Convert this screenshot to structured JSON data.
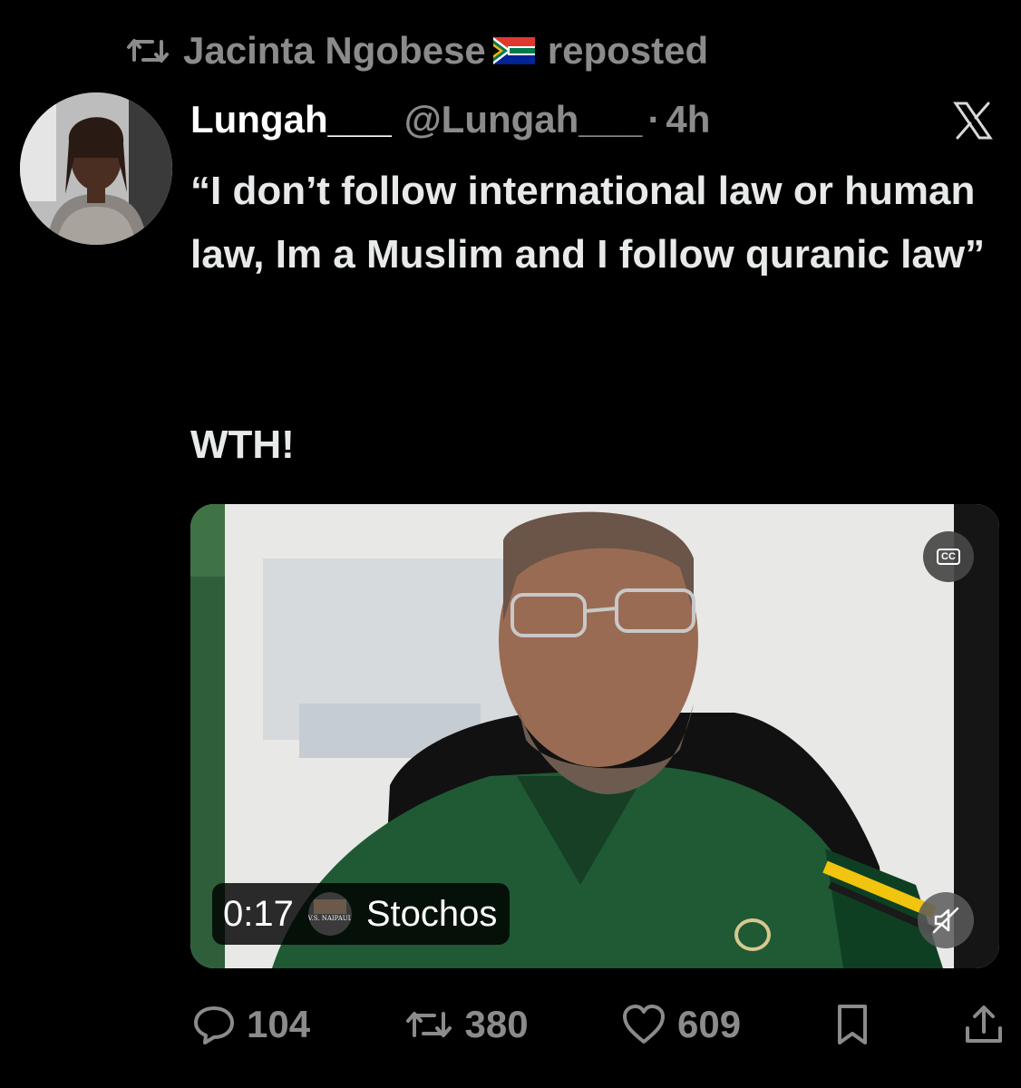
{
  "repost": {
    "name": "Jacinta Ngobese",
    "suffix": "reposted",
    "icon": "repost-icon",
    "flag": "south-africa-flag"
  },
  "tweet": {
    "display_name": "Lungah___",
    "handle": "@Lungah___",
    "separator": "·",
    "time": "4h",
    "text": "“I don’t follow international law or human law, Im a Muslim and I follow quranic law”",
    "text2": "WTH!"
  },
  "video": {
    "duration": "0:17",
    "channel": "Stochos",
    "channel_badge": "V.S. NAIPAUL",
    "cc_label": "CC"
  },
  "actions": {
    "replies": "104",
    "reposts": "380",
    "likes": "609"
  },
  "colors": {
    "background": "#000000",
    "text": "#e7e9ea",
    "muted": "#8b8b8b",
    "shirt": "#1f5a34"
  }
}
